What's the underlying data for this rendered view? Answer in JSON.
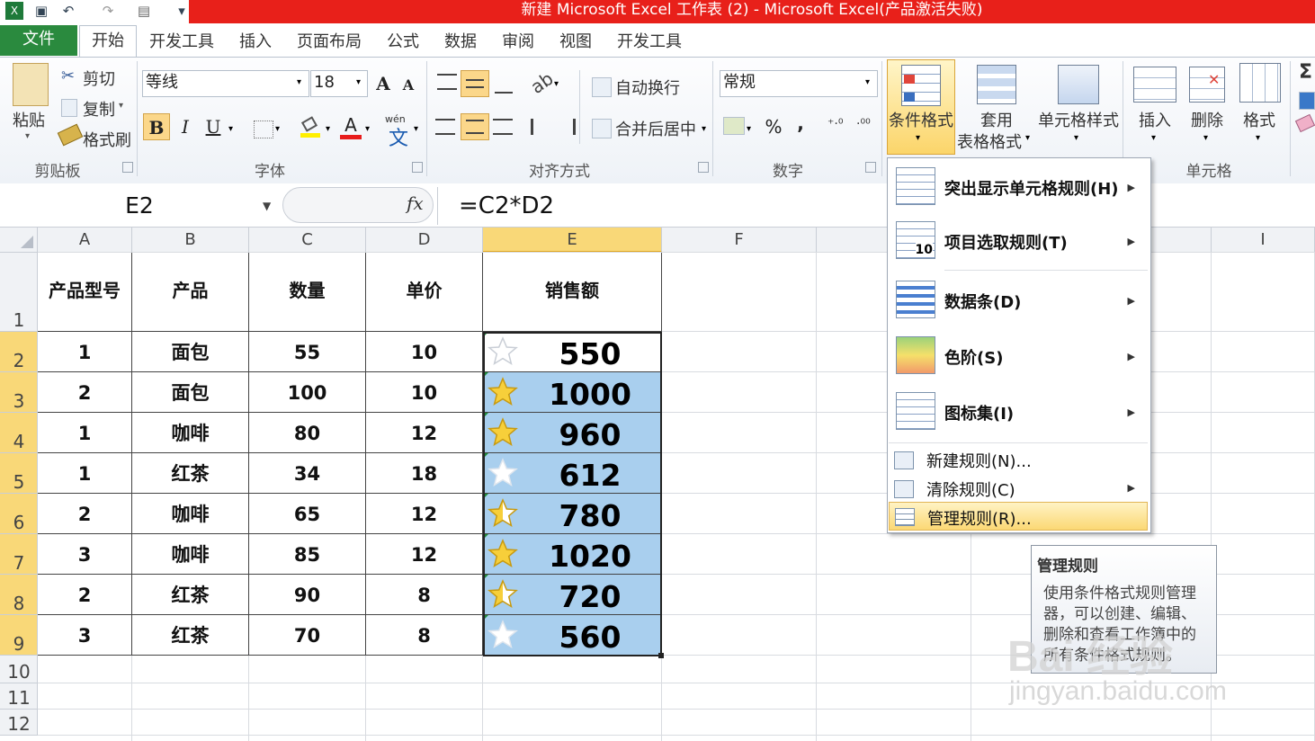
{
  "window": {
    "title": "新建 Microsoft Excel 工作表 (2)  -  Microsoft Excel(产品激活失败)"
  },
  "tabs": [
    "文件",
    "开始",
    "开发工具",
    "插入",
    "页面布局",
    "公式",
    "数据",
    "审阅",
    "视图",
    "开发工具"
  ],
  "ribbon": {
    "clipboard": {
      "paste": "粘贴",
      "cut": "剪切",
      "copy": "复制",
      "format_painter": "格式刷",
      "group": "剪贴板"
    },
    "font": {
      "name": "等线",
      "size": "18",
      "group": "字体",
      "bold": "B",
      "italic": "I",
      "underline": "U",
      "grow": "A",
      "shrink": "A",
      "font_color": "A",
      "wen": "wén"
    },
    "alignment": {
      "wrap": "自动换行",
      "merge": "合并后居中",
      "group": "对齐方式"
    },
    "number": {
      "format": "常规",
      "percent": "%",
      "comma": ",",
      "group": "数字"
    },
    "styles": {
      "conditional": "条件格式",
      "table_format_1": "套用",
      "table_format_2": "表格格式",
      "cell_styles": "单元格样式"
    },
    "cells": {
      "insert": "插入",
      "delete": "删除",
      "format": "格式",
      "group": "单元格"
    },
    "sigma": "Σ"
  },
  "formula_bar": {
    "name_box": "E2",
    "fx": "fx",
    "formula": "=C2*D2"
  },
  "columns": [
    "A",
    "B",
    "C",
    "D",
    "E",
    "F",
    "G",
    "H",
    "I"
  ],
  "rows": [
    "1",
    "2",
    "3",
    "4",
    "5",
    "6",
    "7",
    "8",
    "9",
    "10",
    "11",
    "12"
  ],
  "table": {
    "headers": [
      "产品型号",
      "产品",
      "数量",
      "单价",
      "销售额"
    ],
    "data": [
      [
        "1",
        "面包",
        "55",
        "10",
        "550"
      ],
      [
        "2",
        "面包",
        "100",
        "10",
        "1000"
      ],
      [
        "1",
        "咖啡",
        "80",
        "12",
        "960"
      ],
      [
        "1",
        "红茶",
        "34",
        "18",
        "612"
      ],
      [
        "2",
        "咖啡",
        "65",
        "12",
        "780"
      ],
      [
        "3",
        "咖啡",
        "85",
        "12",
        "1020"
      ],
      [
        "2",
        "红茶",
        "90",
        "8",
        "720"
      ],
      [
        "3",
        "红茶",
        "70",
        "8",
        "560"
      ]
    ],
    "star_levels": [
      "empty",
      "full",
      "full",
      "empty-white",
      "half",
      "full",
      "half",
      "empty-white"
    ]
  },
  "menu": {
    "items": [
      {
        "label": "突出显示单元格规则(H)",
        "icon": "highlight-rules-icon"
      },
      {
        "label": "项目选取规则(T)",
        "icon": "top-bottom-rules-icon"
      },
      {
        "label": "数据条(D)",
        "icon": "data-bars-icon"
      },
      {
        "label": "色阶(S)",
        "icon": "color-scales-icon"
      },
      {
        "label": "图标集(I)",
        "icon": "icon-sets-icon"
      }
    ],
    "new_rule": "新建规则(N)...",
    "clear_rules": "清除规则(C)",
    "manage_rules": "管理规则(R)...",
    "top10": "10"
  },
  "tooltip": {
    "title": "管理规则",
    "body": "使用条件格式规则管理器，可以创建、编辑、删除和查看工作簿中的所有条件格式规则。"
  },
  "watermark": {
    "text": "Bai 经验",
    "url": "jingyan.baidu.com"
  },
  "colors": {
    "accent_green": "#2a8a3e",
    "title_red": "#e8201a",
    "selection_blue": "#a9cfee",
    "highlight": "#f9d878"
  }
}
